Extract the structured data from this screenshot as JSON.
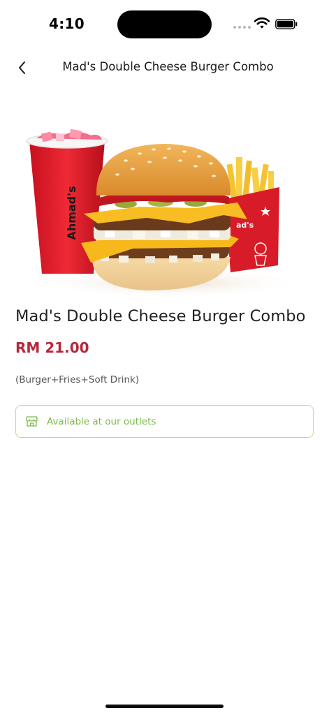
{
  "status_bar": {
    "time": "4:10",
    "icons": [
      "signal-icon",
      "wifi-icon",
      "battery-icon"
    ]
  },
  "header": {
    "title": "Mad's Double Cheese Burger Combo",
    "back_icon": "chevron-left-icon"
  },
  "product": {
    "image_brand_cup": "Ahmad's",
    "image_brand_fries": "ad's",
    "name": "Mad's Double Cheese Burger Combo",
    "price": "RM 21.00",
    "description": "(Burger+Fries+Soft Drink)",
    "availability": {
      "icon": "store-icon",
      "label": "Available at our outlets"
    }
  },
  "colors": {
    "price": "#b8273b",
    "availability_text": "#7bbb4a",
    "availability_border": "#b9dd9a"
  }
}
